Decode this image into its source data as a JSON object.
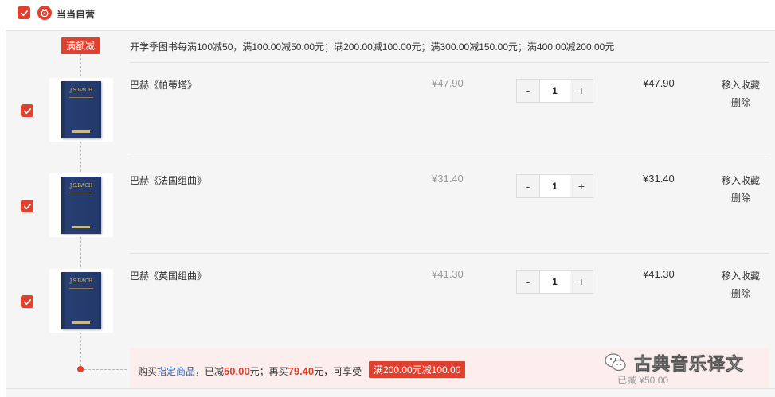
{
  "shop": {
    "name": "当当自营",
    "logo_icon": "dangdang-logo-icon",
    "checked": true
  },
  "promo": {
    "tag": "满额减",
    "text": "开学季图书每满100减50，满100.00减50.00元；满200.00减100.00元；满300.00减150.00元；满400.00减200.00元"
  },
  "items": [
    {
      "checked": true,
      "title": "巴赫《帕蒂塔》",
      "price": "¥47.90",
      "qty": "1",
      "subtotal": "¥47.90",
      "fav": "移入收藏",
      "del": "删除",
      "cover": "J.S.BACH"
    },
    {
      "checked": true,
      "title": "巴赫《法国组曲》",
      "price": "¥31.40",
      "qty": "1",
      "subtotal": "¥31.40",
      "fav": "移入收藏",
      "del": "删除",
      "cover": "J.S.BACH"
    },
    {
      "checked": true,
      "title": "巴赫《英国组曲》",
      "price": "¥41.30",
      "qty": "1",
      "subtotal": "¥41.30",
      "fav": "移入收藏",
      "del": "删除",
      "cover": "J.S.BACH"
    }
  ],
  "stepper": {
    "minus": "-",
    "plus": "+"
  },
  "summary": {
    "p1": "购买",
    "link": "指定商品",
    "p2": "，已减",
    "reduced": "50.00",
    "p3": "元；再买",
    "more": "79.40",
    "p4": "元，可享受",
    "badge": "满200.00元减100.00",
    "saved": "已减  ¥50.00"
  },
  "watermark": {
    "text": "古典音乐译文",
    "icon": "wechat-icon"
  },
  "colors": {
    "accent": "#e2402f",
    "link": "#2a64b4"
  }
}
